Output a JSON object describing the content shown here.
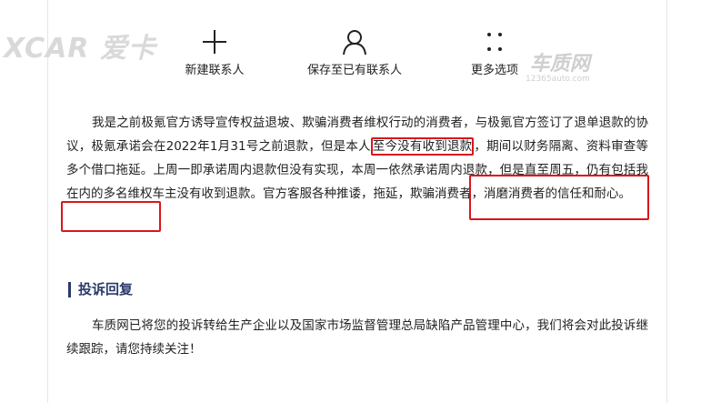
{
  "watermarks": {
    "left_logo": "XCAR 爱卡",
    "right_logo": "车质网",
    "right_url": "12365auto.com"
  },
  "actions": [
    {
      "label": "新建联系人",
      "icon": "plus-icon"
    },
    {
      "label": "保存至已有联系人",
      "icon": "person-icon"
    },
    {
      "label": "更多选项",
      "icon": "more-dots-icon"
    }
  ],
  "complaint": {
    "text_a": "我是之前极氪官方诱导宣传权益退坡、欺骗消费者维权行动的消费者，与极氪官方签订了退单退款的协议，极氪承诺会在2022年1月31号之前退款，但是本人",
    "highlight_1": "至今没有收到退款",
    "text_b": "，期间以财务隔离、资料审查等多个借口拖延。上周一即承诺周内退款但没有实现，本周一依然承诺周内退款，但是直至周五，仍有包括我在内的多名维权车主没有收到退款。官方客服各种推诿，拖延，欺骗消费者，消磨消费者的信任和耐心。"
  },
  "reply": {
    "title": "投诉回复",
    "text": "车质网已将您的投诉转给生产企业以及国家市场监督管理总局缺陷产品管理中心，我们将会对此投诉继续跟踪，请您持续关注！"
  },
  "colors": {
    "highlight": "#d9161c",
    "section_title": "#2b3a6b"
  }
}
